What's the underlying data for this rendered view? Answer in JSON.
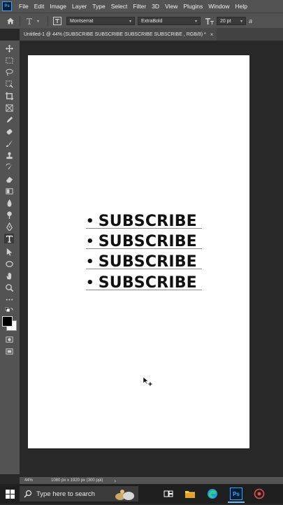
{
  "app": {
    "logo_text": "Ps"
  },
  "menu": [
    "File",
    "Edit",
    "Image",
    "Layer",
    "Type",
    "Select",
    "Filter",
    "3D",
    "View",
    "Plugins",
    "Window",
    "Help"
  ],
  "options": {
    "font_family": "Montserrat",
    "font_style": "ExtraBold",
    "font_size": "20 pt",
    "aa": "a"
  },
  "document": {
    "tab_title": "Untitled-1 @ 44% (SUBSCRIBE SUBSCRIBE SUBSCRIBE SUBSCRIBE , RGB/8) *",
    "lines": [
      "SUBSCRIBE",
      "SUBSCRIBE",
      "SUBSCRIBE",
      "SUBSCRIBE"
    ],
    "bullet": "•"
  },
  "status": {
    "zoom": "44%",
    "dimensions": "1080 px x 1920 px (300 ppi)",
    "arrow": "›"
  },
  "taskbar": {
    "search_placeholder": "Type here to search"
  },
  "colors": {
    "chrome": "#535353",
    "canvas_bg": "#282828",
    "ps_blue": "#31a8ff"
  }
}
